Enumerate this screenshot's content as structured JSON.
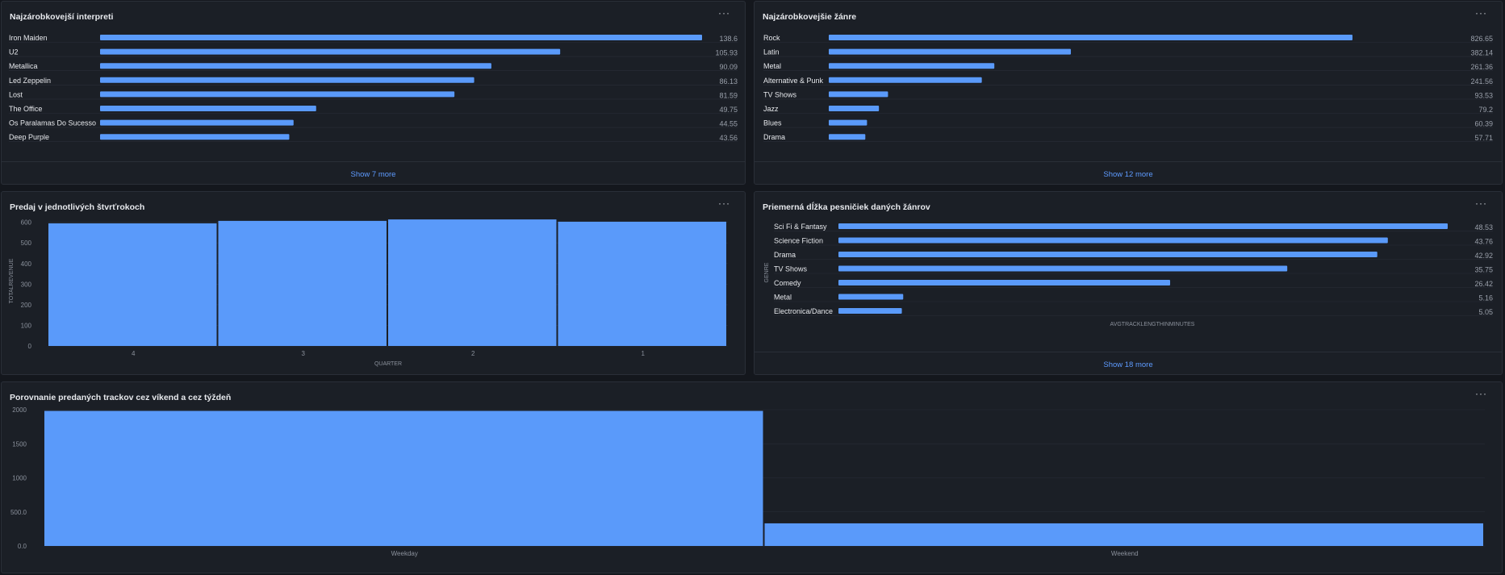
{
  "colors": {
    "bar": "#5a9afa",
    "grid": "#2a2f38",
    "link": "#5e9bff"
  },
  "menu_glyph": "···",
  "panels": {
    "artists": {
      "title": "Najzárobkovejší interpreti",
      "show_more": "Show 7 more"
    },
    "genres": {
      "title": "Najzárobkovejšie žánre",
      "show_more": "Show 12 more"
    },
    "quarters": {
      "title": "Predaj v jednotlivých štvrťrokoch"
    },
    "length": {
      "title": "Priemerná dĺžka pesničiek daných žánrov",
      "show_more": "Show 18 more"
    },
    "weekend": {
      "title": "Porovnanie predaných trackov cez víkend a cez týždeň"
    }
  },
  "chart_data": [
    {
      "id": "artists",
      "type": "bar",
      "orientation": "horizontal",
      "categories": [
        "Iron Maiden",
        "U2",
        "Metallica",
        "Led Zeppelin",
        "Lost",
        "The Office",
        "Os Paralamas Do Sucesso",
        "Deep Purple"
      ],
      "values": [
        138.6,
        105.93,
        90.09,
        86.13,
        81.59,
        49.75,
        44.55,
        43.56
      ],
      "value_labels": [
        "138.6",
        "105.93",
        "90.09",
        "86.13",
        "81.59",
        "49.75",
        "44.55",
        "43.56"
      ]
    },
    {
      "id": "genres",
      "type": "bar",
      "orientation": "horizontal",
      "categories": [
        "Rock",
        "Latin",
        "Metal",
        "Alternative & Punk",
        "TV Shows",
        "Jazz",
        "Blues",
        "Drama"
      ],
      "values": [
        826.65,
        382.14,
        261.36,
        241.56,
        93.53,
        79.2,
        60.39,
        57.71
      ],
      "value_labels": [
        "826.65",
        "382.14",
        "261.36",
        "241.56",
        "93.53",
        "79.2",
        "60.39",
        "57.71"
      ]
    },
    {
      "id": "quarters",
      "type": "bar",
      "categories": [
        "4",
        "3",
        "2",
        "1"
      ],
      "values": [
        595,
        607,
        614,
        603
      ],
      "xlabel": "QUARTER",
      "ylabel": "TOTALREVENUE",
      "yticks": [
        "0",
        "100",
        "200",
        "300",
        "400",
        "500",
        "600"
      ],
      "ylim": [
        0,
        630
      ],
      "grid": true
    },
    {
      "id": "length",
      "type": "bar",
      "orientation": "horizontal",
      "categories": [
        "Sci Fi & Fantasy",
        "Science Fiction",
        "Drama",
        "TV Shows",
        "Comedy",
        "Metal",
        "Electronica/Dance"
      ],
      "values": [
        48.53,
        43.76,
        42.92,
        35.75,
        26.42,
        5.16,
        5.05
      ],
      "value_labels": [
        "48.53",
        "43.76",
        "42.92",
        "35.75",
        "26.42",
        "5.16",
        "5.05"
      ],
      "xlabel": "AVGTRACKLENGTHINMINUTES",
      "ylabel": "GENRE"
    },
    {
      "id": "weekend",
      "type": "bar",
      "categories": [
        "Weekday",
        "Weekend"
      ],
      "values": [
        1982,
        332
      ],
      "yticks": [
        "0.0",
        "500.0",
        "1000",
        "1500",
        "2000"
      ],
      "ylim": [
        0,
        2000
      ],
      "grid": true
    }
  ]
}
